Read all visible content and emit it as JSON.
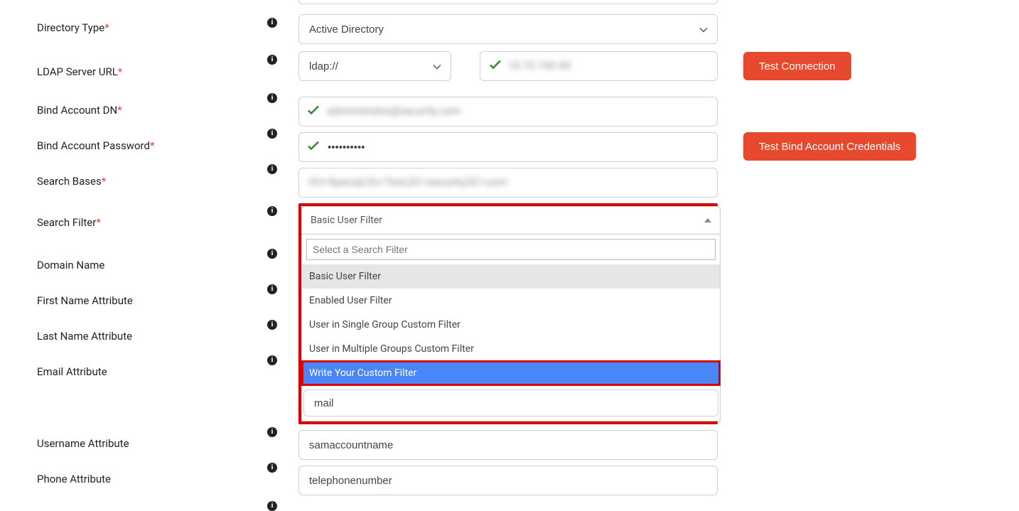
{
  "labels": {
    "directory_type": "Directory Type",
    "ldap_url": "LDAP Server URL",
    "bind_dn": "Bind Account DN",
    "bind_pw": "Bind Account Password",
    "search_bases": "Search Bases",
    "search_filter": "Search Filter",
    "domain_name": "Domain Name",
    "first_name": "First Name Attribute",
    "last_name": "Last Name Attribute",
    "email": "Email Attribute",
    "username": "Username Attribute",
    "phone": "Phone Attribute",
    "required": "*"
  },
  "values": {
    "directory_type": "Active Directory",
    "ldap_scheme": "ldap://",
    "ldap_host_blur": "10.10.100.44",
    "bind_dn_blur": "administrator@security.com",
    "bind_pw_mask": "••••••••••",
    "search_bases_blur": "OU=Special,OU=Test,DC=security,DC=com",
    "email": "mail",
    "username": "samaccountname",
    "phone": "telephonenumber"
  },
  "dropdown": {
    "selected": "Basic User Filter",
    "search_placeholder": "Select a Search Filter",
    "options": [
      "Basic User Filter",
      "Enabled User Filter",
      "User in Single Group Custom Filter",
      "User in Multiple Groups Custom Filter",
      "Write Your Custom Filter"
    ]
  },
  "buttons": {
    "test_conn": "Test Connection",
    "test_bind": "Test Bind Account Credentials"
  }
}
